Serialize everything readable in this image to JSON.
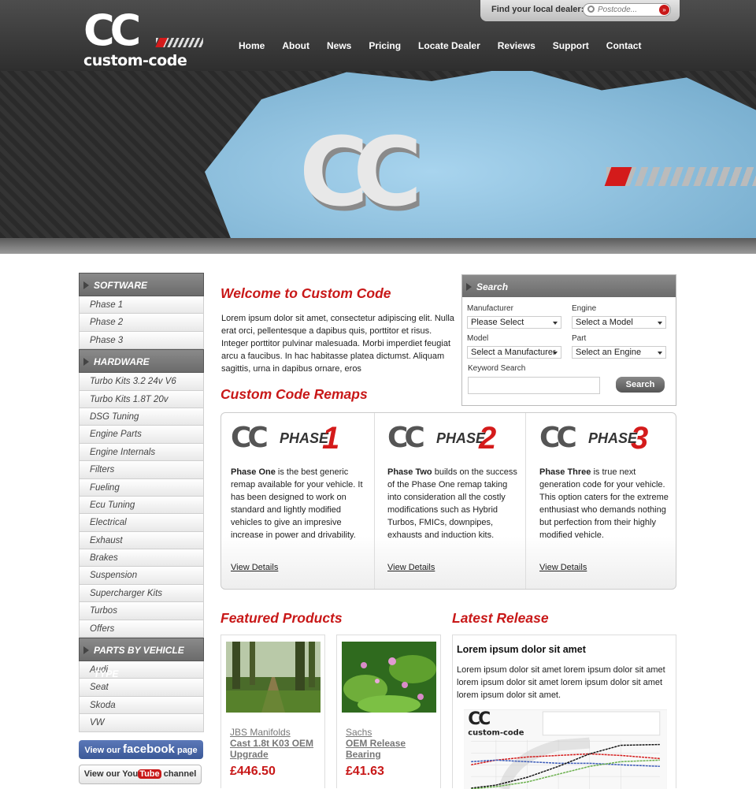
{
  "header": {
    "logo_text": "custom-code",
    "logo_mark": "CC",
    "dealer_label": "Find your local dealer:",
    "dealer_placeholder": "Postcode...",
    "nav": [
      "Home",
      "About",
      "News",
      "Pricing",
      "Locate Dealer",
      "Reviews",
      "Support",
      "Contact"
    ]
  },
  "sidebar": {
    "software_title": "SOFTWARE",
    "software": [
      "Phase 1",
      "Phase 2",
      "Phase 3"
    ],
    "hardware_title": "HARDWARE",
    "hardware": [
      "Turbo Kits 3.2 24v V6",
      "Turbo Kits 1.8T 20v",
      "DSG Tuning",
      "Engine Parts",
      "Engine Internals",
      "Filters",
      "Fueling",
      "Ecu Tuning",
      "Electrical",
      "Exhaust",
      "Brakes",
      "Suspension",
      "Supercharger Kits",
      "Turbos",
      "Offers"
    ],
    "vehicle_title": "PARTS BY VEHICLE TYPE",
    "vehicle": [
      "Audi",
      "Seat",
      "Skoda",
      "VW"
    ],
    "facebook": {
      "pre": "View our",
      "brand": "facebook",
      "post": "page"
    },
    "youtube": {
      "pre": "View our",
      "brand_a": "You",
      "brand_b": "Tube",
      "post": "channel"
    }
  },
  "welcome": {
    "title": "Welcome to Custom Code",
    "text": "Lorem ipsum dolor sit amet, consectetur adipiscing elit. Nulla erat orci, pellentesque a dapibus quis, porttitor et risus. Integer porttitor pulvinar malesuada. Morbi imperdiet feugiat arcu a faucibus. In hac habitasse platea dictumst. Aliquam sagittis, urna in dapibus ornare, eros"
  },
  "search": {
    "title": "Search",
    "manufacturer_label": "Manufacturer",
    "manufacturer_value": "Please Select",
    "engine_label": "Engine",
    "engine_value": "Select a Model",
    "model_label": "Model",
    "model_value": "Select a Manufacturer",
    "part_label": "Part",
    "part_value": "Select an Engine",
    "keyword_label": "Keyword Search",
    "button": "Search"
  },
  "remaps": {
    "title": "Custom Code Remaps",
    "phases": [
      {
        "logo_word": "PHASE",
        "num": "1",
        "bold": "Phase One",
        "text": " is the best generic remap available for your vehicle. It has been designed to work on standard and lightly modified vehicles to give an impresive increase in power and drivability.",
        "link": "View Details"
      },
      {
        "logo_word": "PHASE",
        "num": "2",
        "bold": "Phase Two",
        "text": " builds on the success of the Phase One remap taking into consideration all the costly modifications such as Hybrid Turbos, FMICs, downpipes, exhausts and induction kits.",
        "link": "View Details"
      },
      {
        "logo_word": "PHASE",
        "num": "3",
        "bold": "Phase Three",
        "text": " is true next generation code for your vehicle. This option caters for the extreme enthusiast who demands nothing but perfection from their highly modified vehicle.",
        "link": "View Details"
      }
    ]
  },
  "featured": {
    "title": "Featured Products",
    "products": [
      {
        "category": "JBS Manifolds",
        "name": "Cast 1.8t K03 OEM Upgrade",
        "price": "£446.50"
      },
      {
        "category": "Sachs",
        "name": "OEM Release Bearing",
        "price": "£41.63"
      }
    ]
  },
  "latest": {
    "title": "Latest Release",
    "heading": "Lorem ipsum dolor sit amet",
    "text": "Lorem ipsum dolor sit amet lorem ipsum dolor sit amet lorem ipsum dolor sit amet lorem ipsum dolor sit amet lorem ipsum dolor sit amet.",
    "image_logo": "custom-code"
  },
  "colors": {
    "accent": "#c81818",
    "dark": "#3a3a3a"
  }
}
